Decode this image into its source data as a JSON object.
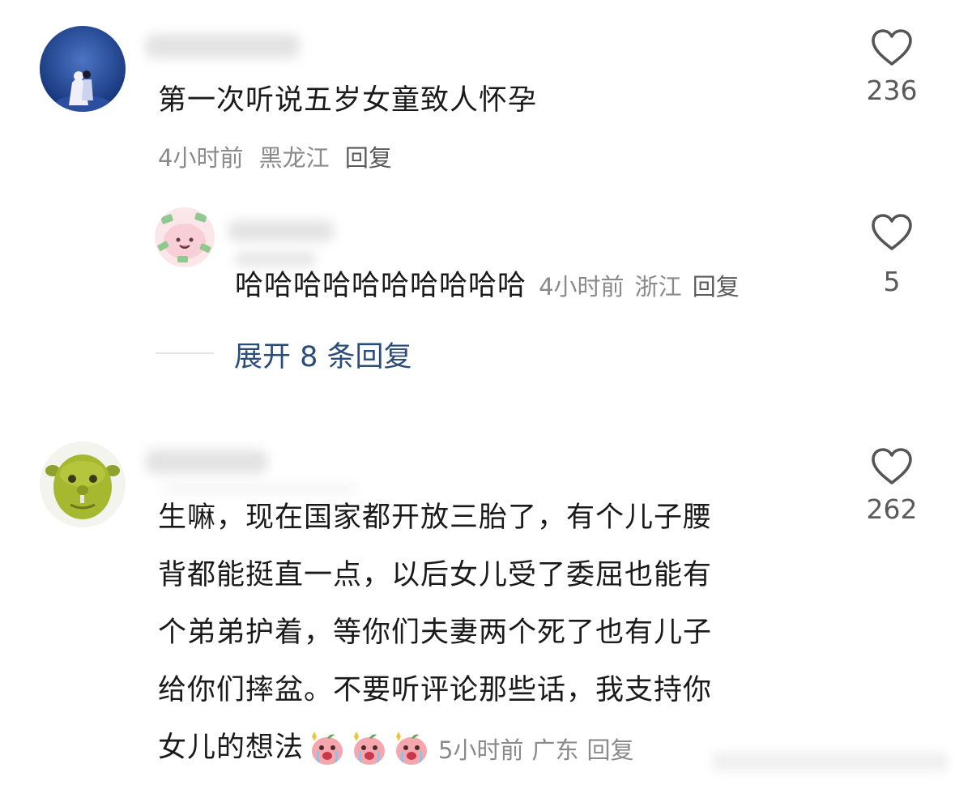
{
  "comments": [
    {
      "text": "第一次听说五岁女童致人怀孕",
      "time": "4小时前",
      "location": "黑龙江",
      "reply_label": "回复",
      "likes": "236",
      "avatar_icon": "couple-night-avatar",
      "reply": {
        "text": "哈哈哈哈哈哈哈哈哈哈",
        "time": "4小时前",
        "location": "浙江",
        "reply_label": "回复",
        "likes": "5",
        "avatar_icon": "pink-money-avatar"
      },
      "expand_label": "展开 8 条回复"
    },
    {
      "text_lines": [
        "生嘛，现在国家都开放三胎了，有个儿子腰",
        "背都能挺直一点，以后女儿受了委屈也能有",
        "个弟弟护着，等你们夫妻两个死了也有儿子",
        "给你们摔盆。不要听评论那些话，我支持你",
        "女儿的想法"
      ],
      "emoji_icon": "crying-peach-emoji",
      "time": "5小时前",
      "location": "广东",
      "reply_label": "回复",
      "likes": "262",
      "avatar_icon": "green-ogre-avatar"
    }
  ],
  "colors": {
    "text": "#1a1a1a",
    "meta": "#8a8a8a",
    "link": "#2a4c7a",
    "heart": "#555555"
  }
}
